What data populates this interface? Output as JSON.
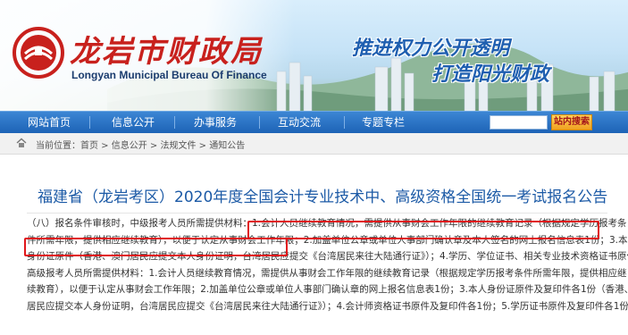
{
  "header": {
    "title_cn": "龙岩市财政局",
    "title_en": "Longyan Municipal Bureau Of Finance",
    "slogan_line1": "推进权力公开透明",
    "slogan_line2": "打造阳光财政"
  },
  "nav": {
    "items": [
      {
        "label": "网站首页"
      },
      {
        "label": "信息公开"
      },
      {
        "label": "办事服务"
      },
      {
        "label": "互动交流"
      },
      {
        "label": "专题专栏"
      }
    ],
    "search_button": "站内搜索"
  },
  "breadcrumb": {
    "text": "当前位置：首页 > 信息公开 > 法规文件 > 通知公告"
  },
  "article": {
    "title": "福建省（龙岩考区）2020年度全国会计专业技术中、高级资格全国统一考试报名公告",
    "lines": [
      "（八）报名条件审核时，中级报考人员所需提供材料：1.会计人员继续教育情况，需提供从事财会工作年限的继续教育记录（根据规定学历报考条",
      "件所需年限，提供相应继续教育），以便于认定从事财会工作年限；2.加盖单位公章或单位人事部门确认章及本人签名的网上报名信息表1份；3.本人",
      "身份证原件（香港、澳门居民应提交本人身份证明，台湾居民应提交《台湾居民来往大陆通行证》）；4.学历、学位证书、相关专业技术资格证书原件。",
      "高级报考人员所需提供材料：1.会计人员继续教育情况，需提供从事财会工作年限的继续教育记录（根据规定学历报考条件所需年限，提供相应继",
      "续教育），以便于认定从事财会工作年限；2.加盖单位公章或单位人事部门确认章的网上报名信息表1份；3.本人身份证原件及复印件各1份（香港、澳门",
      "居民应提交本人身份证明，台湾居民应提交《台湾居民来往大陆通行证》）；4.会计师资格证书原件及复印件各1份；5.学历证书原件及复印件各1份。"
    ]
  },
  "colors": {
    "brand_red": "#c8211d",
    "nav_blue": "#1d63b6",
    "title_blue": "#1c5aa6",
    "highlight_red": "#e0161a"
  }
}
